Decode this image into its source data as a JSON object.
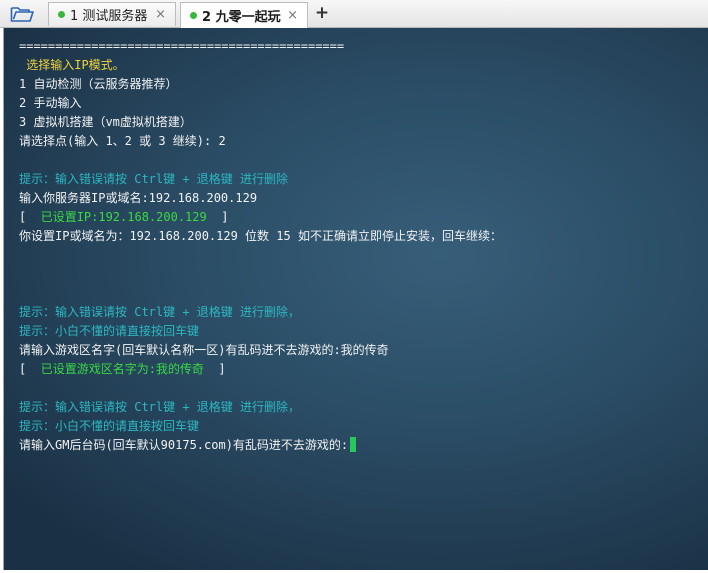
{
  "tabs": [
    {
      "label": "1 测试服务器",
      "status_color": "#38b83a",
      "close": "×"
    },
    {
      "label": "2 九零一起玩",
      "status_color": "#38b83a",
      "close": "×"
    }
  ],
  "add_tab": "+",
  "terminal": {
    "lines": [
      "=============================================",
      " 选择输入IP模式。",
      "1 自动检测（云服务器推荐）",
      "2 手动输入",
      "3 虚拟机搭建（vm虚拟机搭建）",
      "请选择点(输入 1、2 或 3 继续): 2",
      "提示：输入错误请按 Ctrl键 + 退格键 进行删除",
      "输入你服务器IP或域名:192.168.200.129",
      "[  已设置IP:192.168.200.129  ]",
      "你设置IP或域名为：192.168.200.129 位数 15 如不正确请立即停止安装，回车继续：",
      "提示：输入错误请按 Ctrl键 + 退格键 进行删除，",
      "提示：小白不懂的请直接按回车键",
      "请输入游戏区名字(回车默认名称一区)有乱码进不去游戏的:我的传奇",
      "[  已设置游戏区名字为:我的传奇  ]",
      "提示：输入错误请按 Ctrl键 + 退格键 进行删除，",
      "提示：小白不懂的请直接按回车键",
      "请输入GM后台码(回车默认90175.com)有乱码进不去游戏的:"
    ],
    "bracket_open": "[",
    "bracket_close": "]",
    "ip_set_label": "已设置IP:192.168.200.129",
    "zone_set_label": "已设置游戏区名字为:我的传奇"
  }
}
